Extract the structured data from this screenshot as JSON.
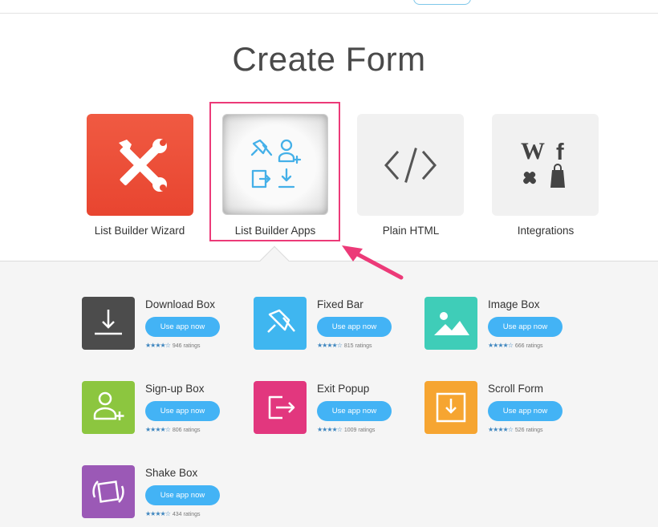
{
  "page": {
    "title": "Create Form"
  },
  "cards": [
    {
      "id": "wizard",
      "label": "List Builder Wizard"
    },
    {
      "id": "apps",
      "label": "List Builder Apps"
    },
    {
      "id": "html",
      "label": "Plain HTML"
    },
    {
      "id": "integrations",
      "label": "Integrations"
    }
  ],
  "apps": [
    {
      "name": "Download Box",
      "button": "Use app now",
      "stars": "★★★★☆",
      "ratings": "946 ratings",
      "color": "#4c4c4c"
    },
    {
      "name": "Fixed Bar",
      "button": "Use app now",
      "stars": "★★★★☆",
      "ratings": "815 ratings",
      "color": "#3fb6f0"
    },
    {
      "name": "Image Box",
      "button": "Use app now",
      "stars": "★★★★☆",
      "ratings": "666 ratings",
      "color": "#3fcdb8"
    },
    {
      "name": "Sign-up Box",
      "button": "Use app now",
      "stars": "★★★★☆",
      "ratings": "806 ratings",
      "color": "#8cc63f"
    },
    {
      "name": "Exit Popup",
      "button": "Use app now",
      "stars": "★★★★☆",
      "ratings": "1009 ratings",
      "color": "#e2377e"
    },
    {
      "name": "Scroll Form",
      "button": "Use app now",
      "stars": "★★★★☆",
      "ratings": "526 ratings",
      "color": "#f6a531"
    },
    {
      "name": "Shake Box",
      "button": "Use app now",
      "stars": "★★★★☆",
      "ratings": "434 ratings",
      "color": "#9b59b6"
    }
  ],
  "colors": {
    "accent": "#43b3f5",
    "highlight": "#ec3a78",
    "wizard": "#ef4f38"
  },
  "icons": {
    "wizard": "tools-icon",
    "apps": "apps-grid-icon",
    "html": "code-icon",
    "integrations": "integrations-icon"
  }
}
